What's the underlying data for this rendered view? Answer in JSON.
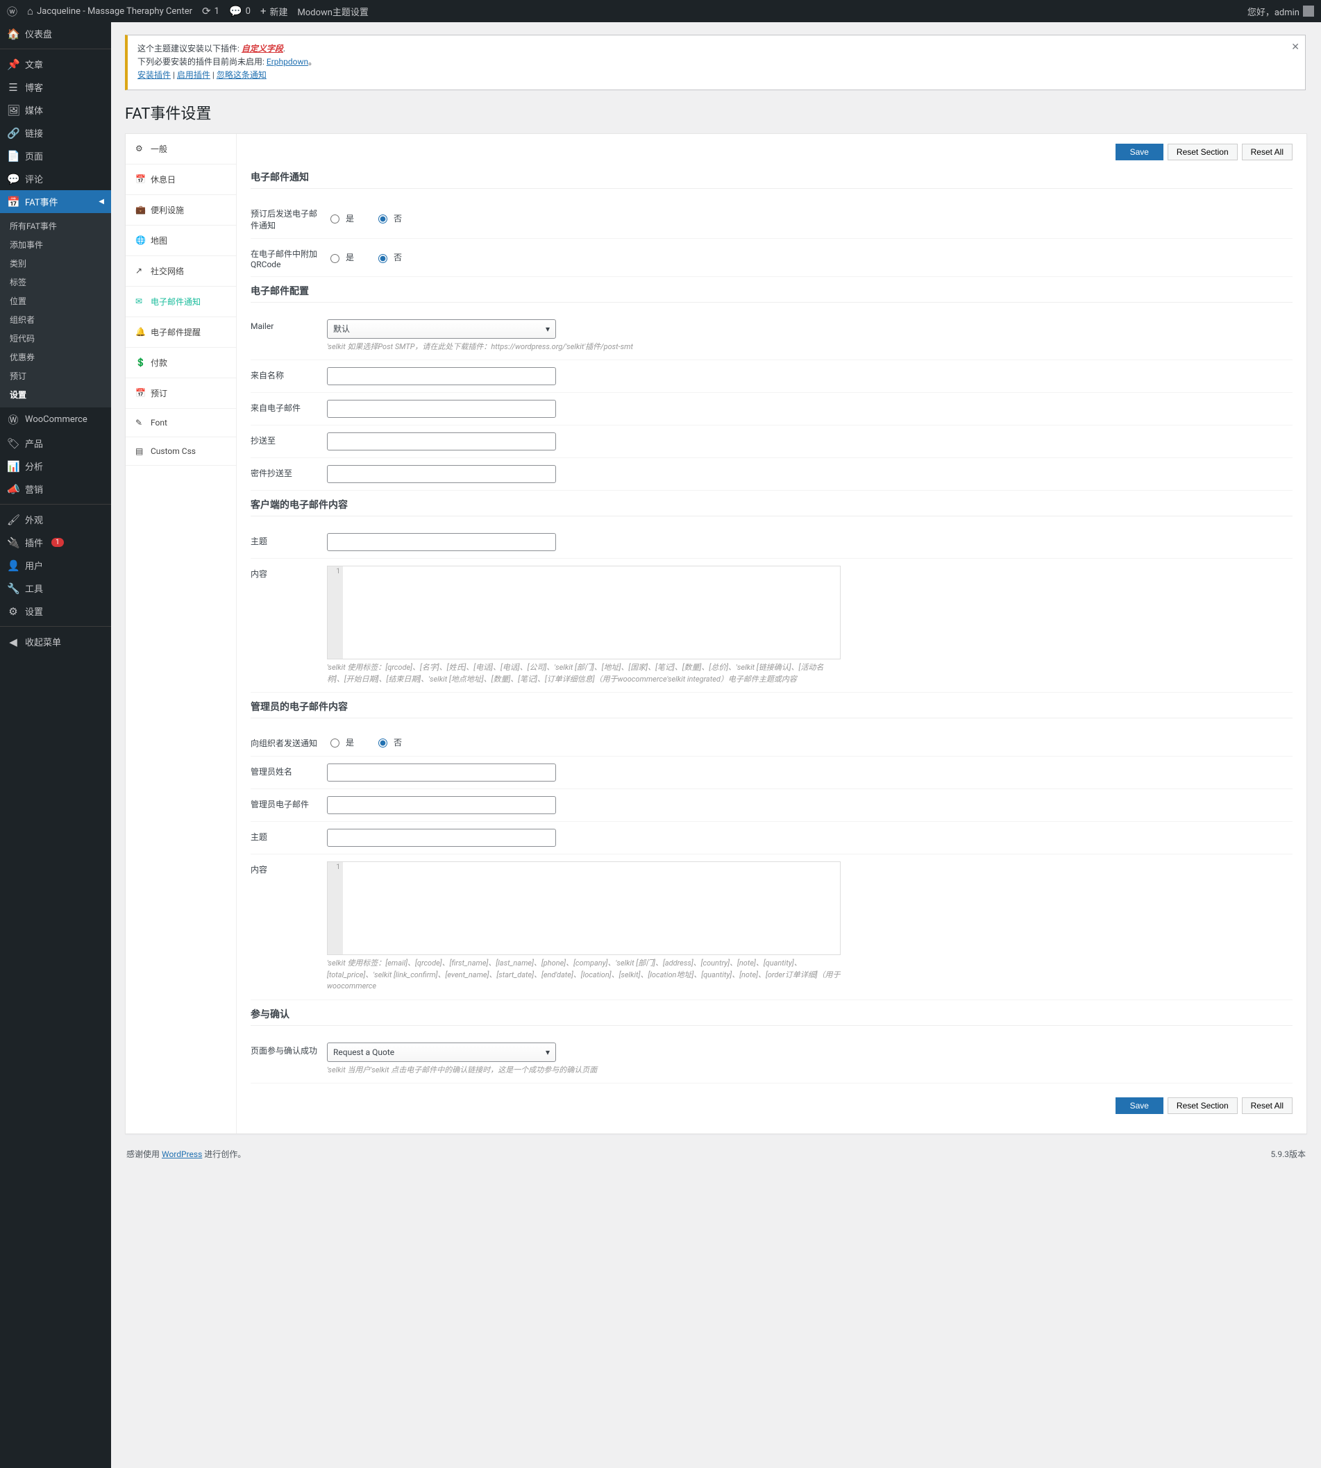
{
  "adminbar": {
    "site": "Jacqueline - Massage Theraphy Center",
    "updates": "1",
    "comments": "0",
    "new": "新建",
    "theme": "Modown主题设置",
    "greeting": "您好，admin"
  },
  "sidenav": {
    "dashboard": "仪表盘",
    "posts": "文章",
    "blog": "博客",
    "media": "媒体",
    "links": "链接",
    "pages": "页面",
    "comments": "评论",
    "fat": "FAT事件",
    "fat_sub": [
      "所有FAT事件",
      "添加事件",
      "类别",
      "标签",
      "位置",
      "组织者",
      "短代码",
      "优惠券",
      "预订",
      "设置"
    ],
    "woo": "WooCommerce",
    "products": "产品",
    "analytics": "分析",
    "marketing": "营销",
    "appearance": "外观",
    "plugins": "插件",
    "plugins_badge": "1",
    "users": "用户",
    "tools": "工具",
    "settings": "设置",
    "collapse": "收起菜单"
  },
  "notice": {
    "l1a": "这个主题建议安装以下插件: ",
    "l1b": "自定义字段",
    "l2a": "下列必要安装的插件目前尚未启用: ",
    "l2b": "Erphpdown",
    "a1": "安装插件",
    "a2": "启用插件",
    "a3": "忽略这条通知"
  },
  "page_title": "FAT事件设置",
  "tabs": [
    "一般",
    "休息日",
    "便利设施",
    "地图",
    "社交网络",
    "电子邮件通知",
    "电子邮件提醒",
    "付款",
    "预订",
    "Font",
    "Custom Css"
  ],
  "btns": {
    "save": "Save",
    "reset_sec": "Reset Section",
    "reset_all": "Reset All"
  },
  "sec": {
    "s1": "电子邮件通知",
    "s2": "电子邮件配置",
    "s3": "客户端的电子邮件内容",
    "s4": "管理员的电子邮件内容",
    "s5": "参与确认"
  },
  "labels": {
    "f1": "预订后发送电子邮件通知",
    "f2": "在电子邮件中附加QRCode",
    "yes": "是",
    "no": "否",
    "mailer": "Mailer",
    "mailer_val": "默认",
    "mailer_help": "'selkit 如果选择Post SMTP，请在此处下载插件：https://wordpress.org/'selkit'插件/post-smt",
    "from_name": "来自名称",
    "from_email": "来自电子邮件",
    "cc": "抄送至",
    "bcc": "密件抄送至",
    "subject": "主题",
    "content": "内容",
    "content_help1": "'selkit 使用标签：[qrcode]、[名字]、[姓氏]、[电话]、[电话]、[公司]、'selkit [部门]、[地址]、[国家]、[笔记]、[数量]、[总价]、'selkit [链接确认]、[活动名称]、[开始日期]、[结束日期]、'selkit [地点地址]、[数量]、[笔记]、[订单详细信息]（用于woocommerce'selkit integrated）电子邮件主题或内容",
    "send_org": "向组织者发送通知",
    "admin_name": "管理员姓名",
    "admin_email": "管理员电子邮件",
    "content_help2": "'selkit 使用标签：[email]、[qrcode]、[first_name]、[last_name]、[phone]、[company]、'selkit [部门]、[address]、[country]、[note]、[quantity]、[total_price]、'selkit [link_confirm]、[event_name]、[start_date]、[end'date]、[location]、[selkit]、[location地址]、[quantity]、[note]、[order订单详细]（用于woocommerce",
    "page_confirm": "页面参与确认成功",
    "page_confirm_val": "Request a Quote",
    "page_confirm_help": "'selkit 当用户'selkit 点击电子邮件中的确认链接时，这是一个成功参与的确认页面"
  },
  "footer": {
    "left1": "感谢使用 ",
    "left2": "WordPress",
    "left3": " 进行创作。",
    "right": "5.9.3版本"
  },
  "gutter": "1"
}
